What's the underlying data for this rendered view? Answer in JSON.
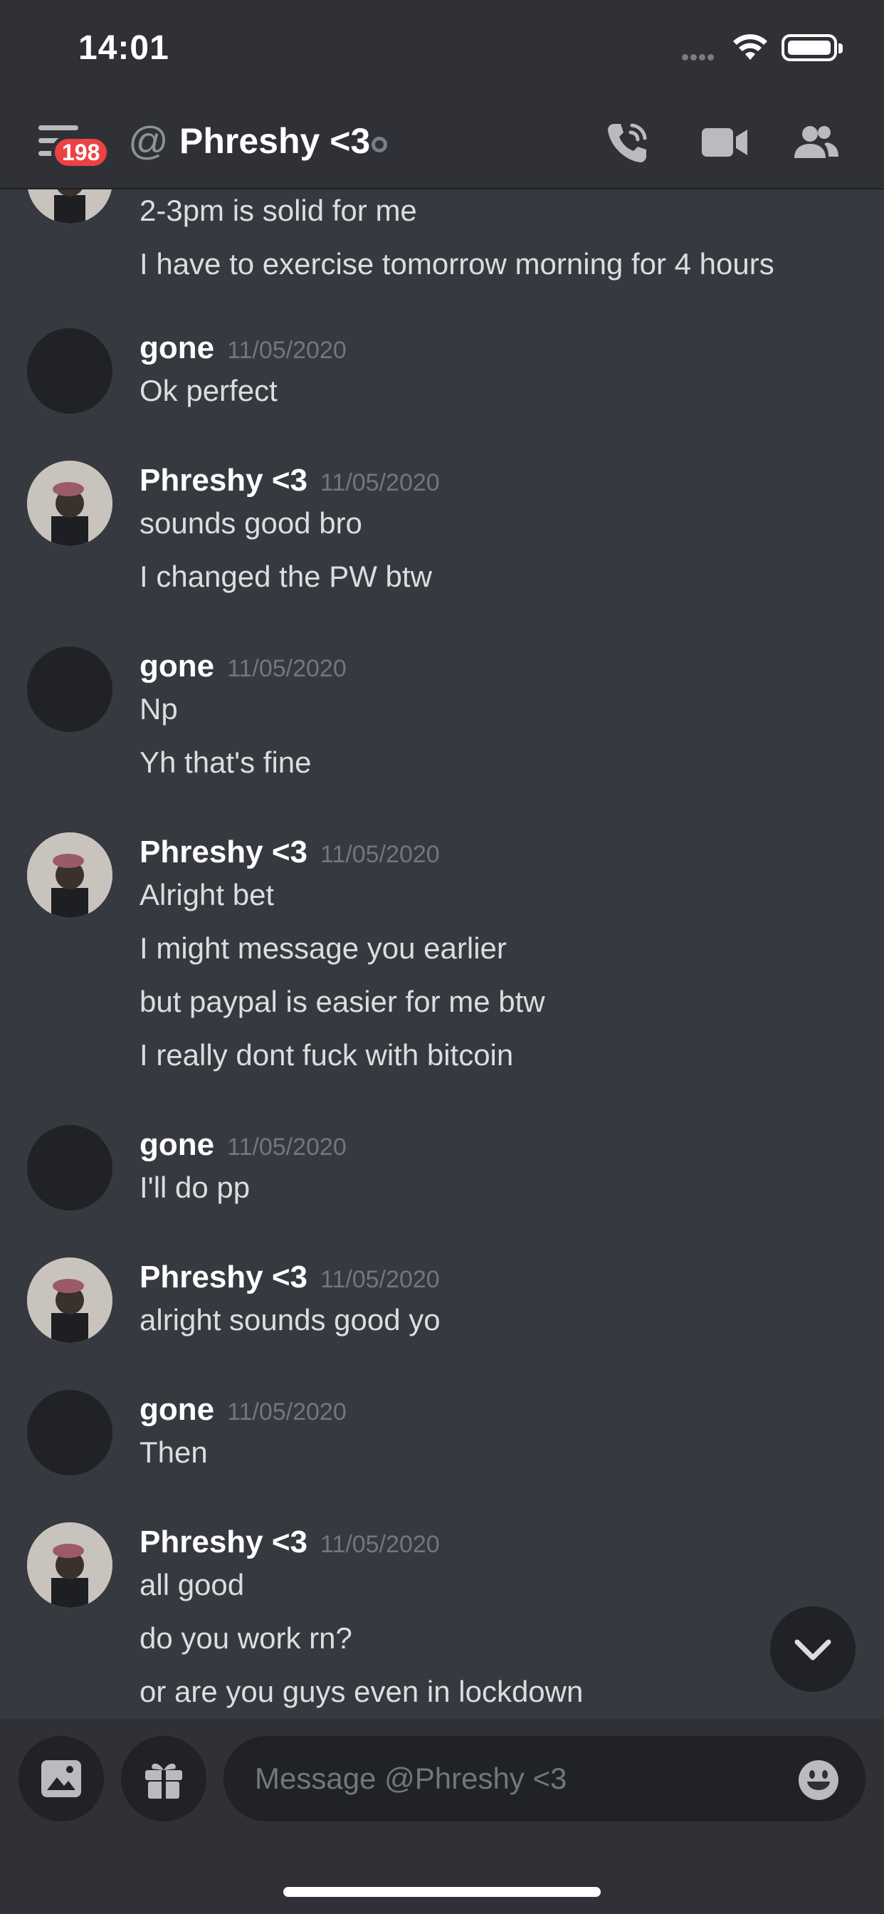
{
  "status_bar": {
    "time": "14:01"
  },
  "header": {
    "badge_count": "198",
    "at_symbol": "@",
    "title": "Phreshy <3",
    "icons": [
      "menu-icon",
      "call-icon",
      "video-icon",
      "members-icon"
    ]
  },
  "messages": [
    {
      "author": "",
      "timestamp": "",
      "lines": [
        "2-3pm is solid for me",
        "I have to exercise tomorrow morning for 4 hours"
      ]
    },
    {
      "author": "gone",
      "timestamp": "11/05/2020",
      "lines": [
        "Ok perfect"
      ]
    },
    {
      "author": "Phreshy <3",
      "timestamp": "11/05/2020",
      "lines": [
        "sounds good bro",
        "I changed the PW btw"
      ]
    },
    {
      "author": "gone",
      "timestamp": "11/05/2020",
      "lines": [
        "Np",
        "Yh that's fine"
      ]
    },
    {
      "author": "Phreshy <3",
      "timestamp": "11/05/2020",
      "lines": [
        "Alright bet",
        "I might message you earlier",
        "but paypal is easier for me btw",
        "I really dont fuck with bitcoin"
      ]
    },
    {
      "author": "gone",
      "timestamp": "11/05/2020",
      "lines": [
        "I'll do pp"
      ]
    },
    {
      "author": "Phreshy <3",
      "timestamp": "11/05/2020",
      "lines": [
        "alright sounds good yo"
      ]
    },
    {
      "author": "gone",
      "timestamp": "11/05/2020",
      "lines": [
        "Then"
      ]
    },
    {
      "author": "Phreshy <3",
      "timestamp": "11/05/2020",
      "lines": [
        "all good",
        "do you work rn?",
        "or are you guys even in lockdown"
      ]
    }
  ],
  "composer": {
    "placeholder": "Message @Phreshy <3",
    "icons": [
      "image-icon",
      "gift-icon",
      "emoji-icon"
    ]
  },
  "colors": {
    "background": "#36393f",
    "header": "#2f3136",
    "badge": "#ed4245",
    "input": "#202225"
  }
}
